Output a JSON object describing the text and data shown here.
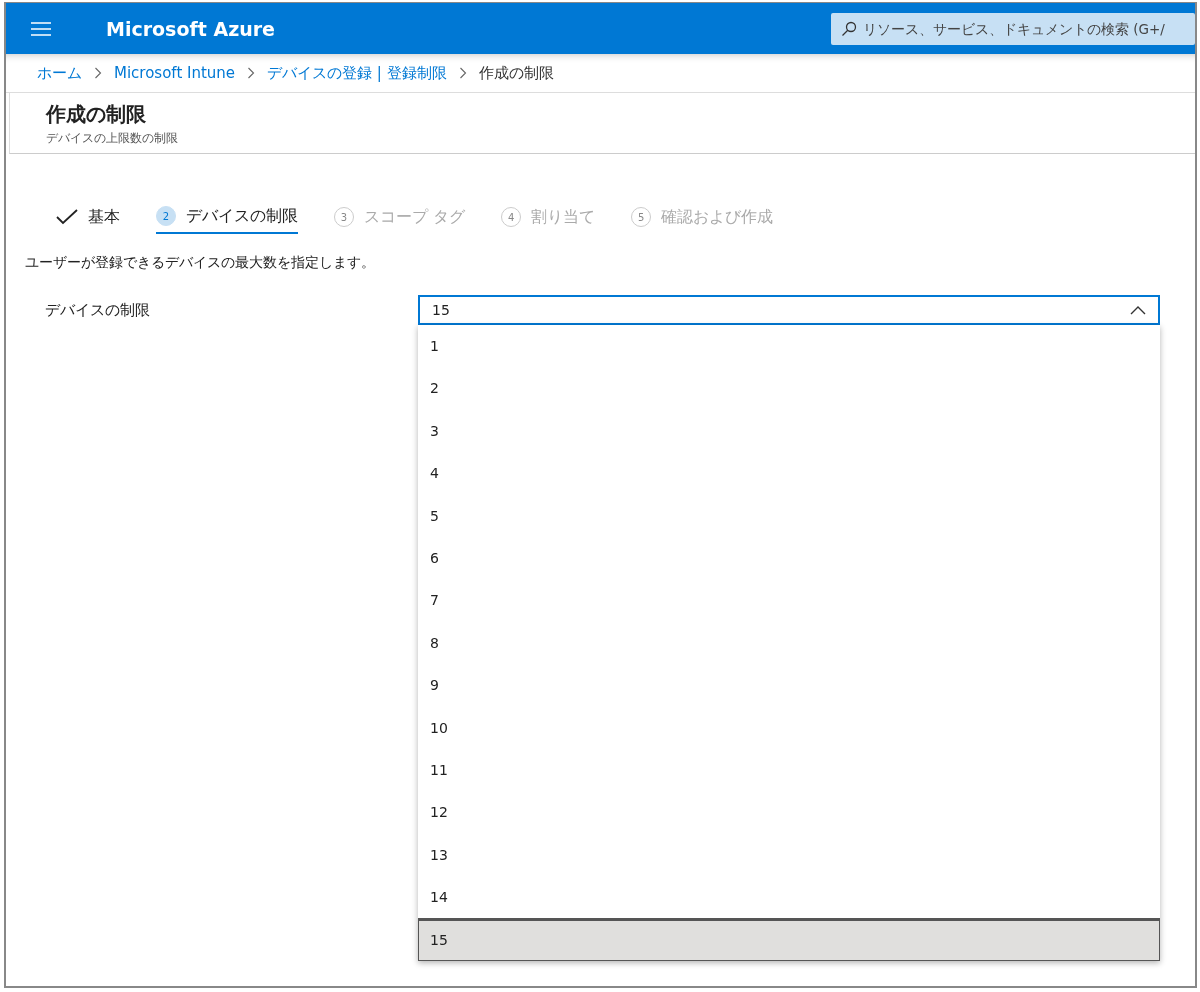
{
  "header": {
    "app_title": "Microsoft Azure",
    "search": {
      "placeholder": "リソース、サービス、ドキュメントの検索 (G+/"
    }
  },
  "breadcrumb": [
    {
      "label": "ホーム",
      "link": true
    },
    {
      "label": "Microsoft Intune",
      "link": true
    },
    {
      "label": "デバイスの登録 | 登録制限",
      "link": true
    },
    {
      "label": "作成の制限",
      "link": false
    }
  ],
  "page": {
    "title": "作成の制限",
    "subtitle": "デバイスの上限数の制限"
  },
  "steps": [
    {
      "label": "基本",
      "completed": true,
      "selected": false
    },
    {
      "number": "2",
      "label": "デバイスの制限",
      "completed": false,
      "selected": true
    },
    {
      "number": "3",
      "label": "スコープ タグ",
      "completed": false,
      "selected": false
    },
    {
      "number": "4",
      "label": "割り当て",
      "completed": false,
      "selected": false
    },
    {
      "number": "5",
      "label": "確認および作成",
      "completed": false,
      "selected": false
    }
  ],
  "description": "ユーザーが登録できるデバイスの最大数を指定します。",
  "field": {
    "label": "デバイスの制限",
    "value": "15",
    "expanded": true,
    "options": [
      {
        "label": "1",
        "selected": false
      },
      {
        "label": "2",
        "selected": false
      },
      {
        "label": "3",
        "selected": false
      },
      {
        "label": "4",
        "selected": false
      },
      {
        "label": "5",
        "selected": false
      },
      {
        "label": "6",
        "selected": false
      },
      {
        "label": "7",
        "selected": false
      },
      {
        "label": "8",
        "selected": false
      },
      {
        "label": "9",
        "selected": false
      },
      {
        "label": "10",
        "selected": false
      },
      {
        "label": "11",
        "selected": false
      },
      {
        "label": "12",
        "selected": false
      },
      {
        "label": "13",
        "selected": false
      },
      {
        "label": "14",
        "selected": false
      },
      {
        "label": "15",
        "selected": true
      }
    ]
  }
}
